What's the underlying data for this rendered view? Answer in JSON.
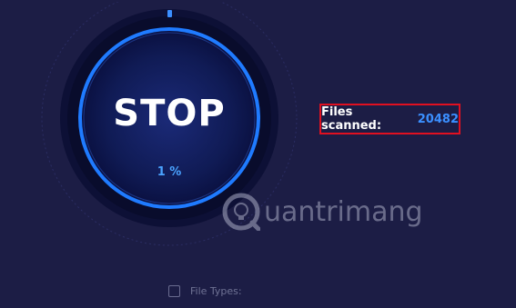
{
  "scanner": {
    "stop_label": "STOP",
    "progress_label": "1 %",
    "progress_value": 1
  },
  "stats": {
    "files_scanned_label": "Files scanned:",
    "files_scanned_count": "20482"
  },
  "watermark": {
    "text": "uantrimang"
  },
  "options": {
    "file_types_label": "File Types:"
  },
  "colors": {
    "background": "#1c1d45",
    "ring": "#1f7bff",
    "accent_text": "#3b8fff",
    "highlight_border": "#e01020"
  }
}
